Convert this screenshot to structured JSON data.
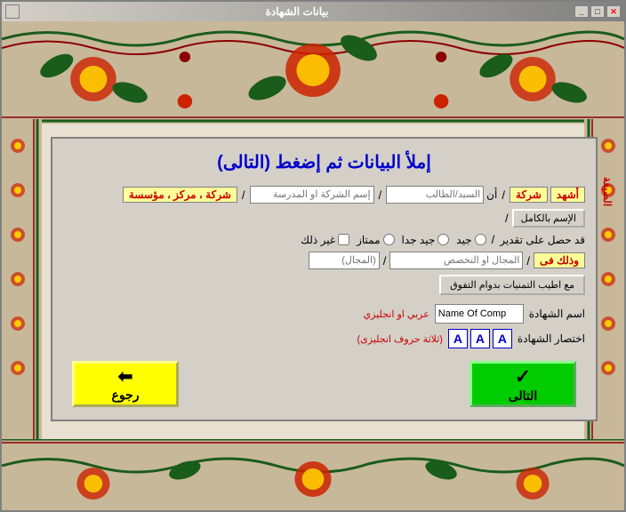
{
  "window": {
    "title": "بيانات الشهادة",
    "icon": "📋"
  },
  "titlebar": {
    "close": "✕",
    "minimize": "_",
    "maximize": "□"
  },
  "heading": "إملأ البيانات ثم إضغط   (التالى)",
  "sygha_label": "الصيغة",
  "row1": {
    "label1": "أشهد",
    "label2": "شركة",
    "sep1": "/",
    "label3": "أن",
    "placeholder3": "السيد/الطالب",
    "sep2": "/",
    "placeholder4": "إسم الشركة او المدرسة",
    "sep3": "/",
    "label4": "شركة ، مركز ، مؤسسة"
  },
  "row2": {
    "label_full": "الإسم بالكامل",
    "sep": "/"
  },
  "row3": {
    "label": "قد حصل على تقدير",
    "sep": "/",
    "options": [
      "جيد",
      "جيد جدا",
      "ممتاز",
      "غير ذلك"
    ]
  },
  "row4": {
    "label": "وذلك فى",
    "sep": "/",
    "placeholder1": "المجال او التخصص",
    "placeholder2": "(المجال)"
  },
  "row5": {
    "button_label": "مع اطيب التمنيات بدوام التفوق"
  },
  "name_section": {
    "label": "اسم الشهادة",
    "input_value": "Name Of Comp",
    "lang_label": "عربي او انجليزي"
  },
  "abbr_section": {
    "label": "اختصار الشهادة",
    "hint": "(ثلاثة حروف انجليزى)",
    "letters": [
      "A",
      "A",
      "A"
    ]
  },
  "buttons": {
    "next_label": "التالى",
    "next_icon": "✓",
    "back_label": "رجوع",
    "back_icon": "⬅"
  }
}
